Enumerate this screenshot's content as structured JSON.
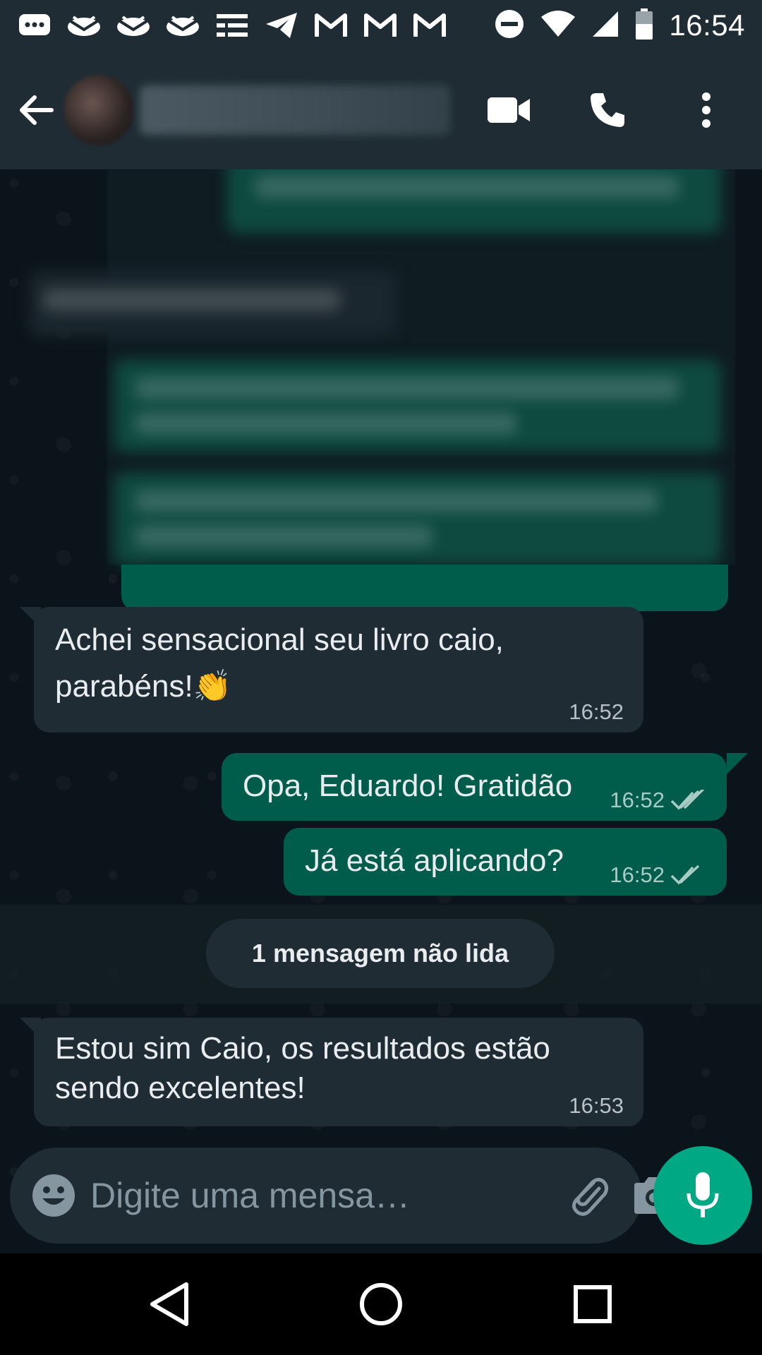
{
  "status_bar": {
    "time": "16:54",
    "icons": [
      "message-icon",
      "mail-icon",
      "mail-icon",
      "mail-icon",
      "list-icon",
      "telegram-icon",
      "gmail-icon",
      "gmail-icon",
      "gmail-icon",
      "dnd-icon",
      "wifi-icon",
      "signal-icon",
      "battery-icon"
    ]
  },
  "header": {
    "contact_name": "",
    "actions": [
      "video-call-icon",
      "voice-call-icon",
      "more-options-icon"
    ]
  },
  "messages": [
    {
      "direction": "incoming",
      "text_line1": "Achei sensacional seu livro caio,",
      "text_line2": "parabéns!👏",
      "time": "16:52"
    },
    {
      "direction": "outgoing",
      "text": "Opa, Eduardo! Gratidão",
      "time": "16:52",
      "status": "read"
    },
    {
      "direction": "outgoing",
      "text": "Já está aplicando?",
      "time": "16:52",
      "status": "read"
    },
    {
      "direction": "incoming",
      "text_line1": "Estou sim Caio, os resultados estão",
      "text_line2": "sendo excelentes!",
      "time": "16:53"
    }
  ],
  "unread_banner": "1 mensagem não lida",
  "composer": {
    "placeholder": "Digite uma mensa…"
  },
  "colors": {
    "incoming_bubble": "#1f2c34",
    "outgoing_bubble": "#005c4b",
    "accent": "#00a884",
    "chat_background": "#0b141a"
  }
}
